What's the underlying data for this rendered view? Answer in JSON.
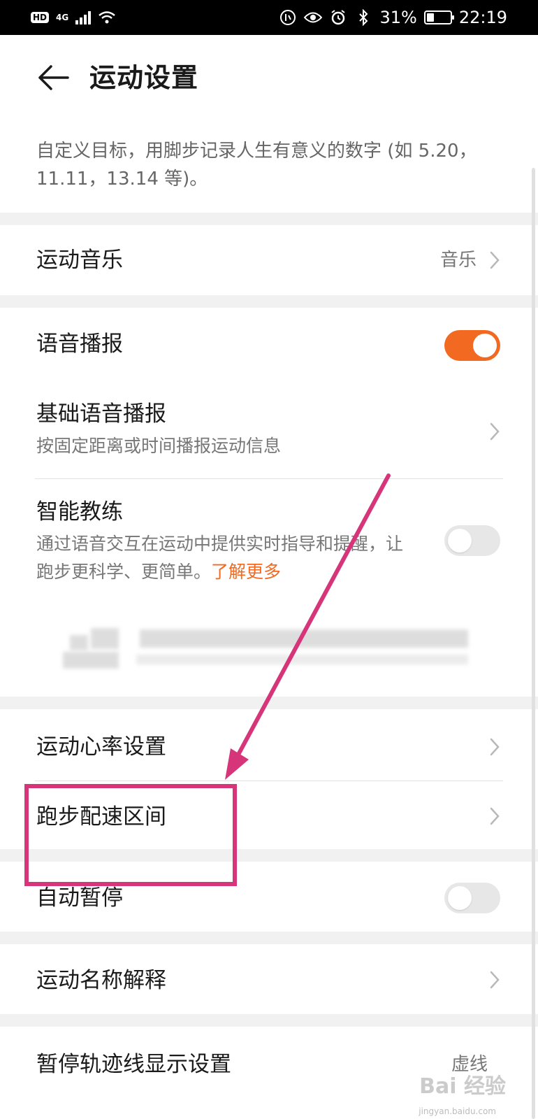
{
  "status_bar": {
    "hd": "HD",
    "network": "4G",
    "battery": "31%",
    "battery_level": 0.31,
    "time": "22:19",
    "icons": [
      "signal-icon",
      "wifi-icon",
      "data-saver-icon",
      "eye-icon",
      "alarm-icon",
      "bluetooth-icon",
      "battery-icon"
    ]
  },
  "header": {
    "title": "运动设置",
    "back_icon": "back-arrow-icon"
  },
  "description": "自定义目标，用脚步记录人生有意义的数字 (如 5.20，11.11，13.14 等)。",
  "settings": {
    "music": {
      "label": "运动音乐",
      "value": "音乐"
    },
    "voice": {
      "label": "语音播报",
      "enabled": true
    },
    "basic_voice": {
      "label": "基础语音播报",
      "subtitle": "按固定距离或时间播报运动信息"
    },
    "coach": {
      "label": "智能教练",
      "subtitle": "通过语音交互在运动中提供实时指导和提醒，让跑步更科学、更简单。",
      "link": "了解更多",
      "enabled": false
    },
    "heart_rate": {
      "label": "运动心率设置"
    },
    "pace_zone": {
      "label": "跑步配速区间"
    },
    "auto_pause": {
      "label": "自动暂停",
      "enabled": false
    },
    "name_explain": {
      "label": "运动名称解释"
    },
    "pause_track": {
      "label": "暂停轨迹线显示设置",
      "value": "虚线"
    }
  },
  "colors": {
    "accent": "#f26a22",
    "annotation": "#d6357a"
  },
  "watermark": {
    "text": "Bai 经验",
    "sub": "jingyan.baidu.com"
  }
}
